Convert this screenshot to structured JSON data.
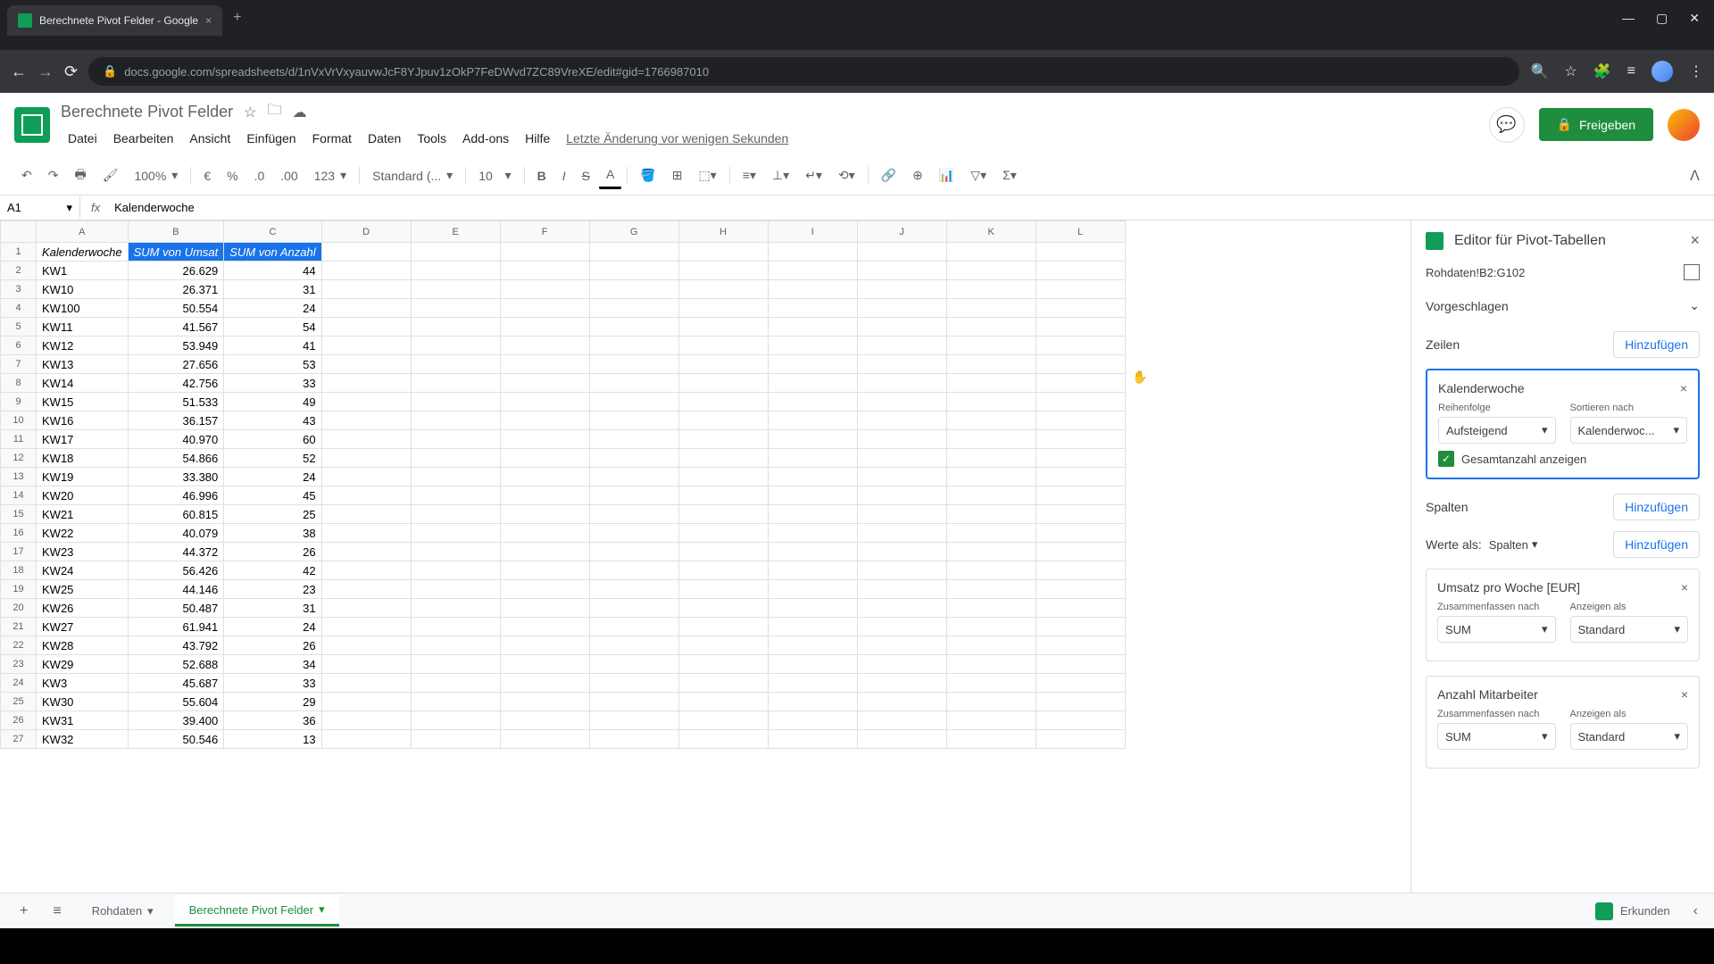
{
  "browser": {
    "tab_title": "Berechnete Pivot Felder - Google",
    "url": "docs.google.com/spreadsheets/d/1nVxVrVxyauvwJcF8YJpuv1zOkP7FeDWvd7ZC89VreXE/edit#gid=1766987010"
  },
  "doc": {
    "title": "Berechnete Pivot Felder",
    "last_edit": "Letzte Änderung vor wenigen Sekunden",
    "share": "Freigeben"
  },
  "menu": [
    "Datei",
    "Bearbeiten",
    "Ansicht",
    "Einfügen",
    "Format",
    "Daten",
    "Tools",
    "Add-ons",
    "Hilfe"
  ],
  "toolbar": {
    "zoom": "100%",
    "font": "Standard (...",
    "size": "10",
    "format_number": "123"
  },
  "namebox": "A1",
  "formula": "Kalenderwoche",
  "columns": [
    "A",
    "B",
    "C",
    "D",
    "E",
    "F",
    "G",
    "H",
    "I",
    "J",
    "K",
    "L"
  ],
  "headers": [
    "Kalenderwoche",
    "SUM von Umsat",
    "SUM von Anzahl"
  ],
  "rows": [
    [
      "KW1",
      "26.629",
      "44"
    ],
    [
      "KW10",
      "26.371",
      "31"
    ],
    [
      "KW100",
      "50.554",
      "24"
    ],
    [
      "KW11",
      "41.567",
      "54"
    ],
    [
      "KW12",
      "53.949",
      "41"
    ],
    [
      "KW13",
      "27.656",
      "53"
    ],
    [
      "KW14",
      "42.756",
      "33"
    ],
    [
      "KW15",
      "51.533",
      "49"
    ],
    [
      "KW16",
      "36.157",
      "43"
    ],
    [
      "KW17",
      "40.970",
      "60"
    ],
    [
      "KW18",
      "54.866",
      "52"
    ],
    [
      "KW19",
      "33.380",
      "24"
    ],
    [
      "KW20",
      "46.996",
      "45"
    ],
    [
      "KW21",
      "60.815",
      "25"
    ],
    [
      "KW22",
      "40.079",
      "38"
    ],
    [
      "KW23",
      "44.372",
      "26"
    ],
    [
      "KW24",
      "56.426",
      "42"
    ],
    [
      "KW25",
      "44.146",
      "23"
    ],
    [
      "KW26",
      "50.487",
      "31"
    ],
    [
      "KW27",
      "61.941",
      "24"
    ],
    [
      "KW28",
      "43.792",
      "26"
    ],
    [
      "KW29",
      "52.688",
      "34"
    ],
    [
      "KW3",
      "45.687",
      "33"
    ],
    [
      "KW30",
      "55.604",
      "29"
    ],
    [
      "KW31",
      "39.400",
      "36"
    ],
    [
      "KW32",
      "50.546",
      "13"
    ]
  ],
  "pivot": {
    "title": "Editor für Pivot-Tabellen",
    "range": "Rohdaten!B2:G102",
    "suggested": "Vorgeschlagen",
    "rows_label": "Zeilen",
    "cols_label": "Spalten",
    "add": "Hinzufügen",
    "values_as": "Werte als:",
    "values_select": "Spalten",
    "field_kw": {
      "name": "Kalenderwoche",
      "order_label": "Reihenfolge",
      "order_value": "Aufsteigend",
      "sort_label": "Sortieren nach",
      "sort_value": "Kalenderwoc...",
      "totals": "Gesamtanzahl anzeigen"
    },
    "field_umsatz": {
      "name": "Umsatz pro Woche [EUR]",
      "sum_label": "Zusammenfassen nach",
      "sum_value": "SUM",
      "show_label": "Anzeigen als",
      "show_value": "Standard"
    },
    "field_anzahl": {
      "name": "Anzahl Mitarbeiter",
      "sum_label": "Zusammenfassen nach",
      "sum_value": "SUM",
      "show_label": "Anzeigen als",
      "show_value": "Standard"
    }
  },
  "tabs": {
    "rohdaten": "Rohdaten",
    "pivot": "Berechnete Pivot Felder",
    "explore": "Erkunden"
  }
}
